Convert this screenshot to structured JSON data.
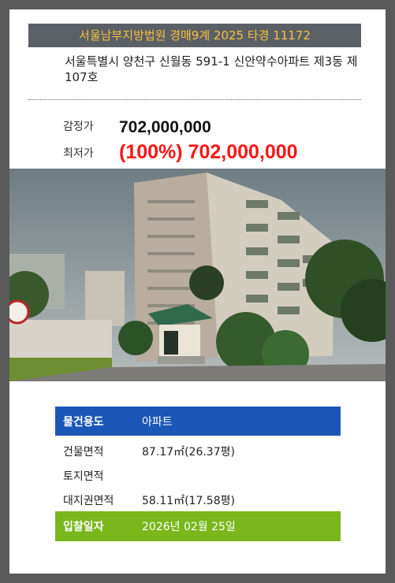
{
  "header": {
    "title": "서울남부지방법원 경매9계 2025 타경 11172"
  },
  "property": {
    "address": "서울특별시 양천구 신월동 591-1 신안약수아파트 제3동 제107호"
  },
  "prices": {
    "appraisal_label": "감정가",
    "appraisal_value": "702,000,000",
    "minimum_label": "최저가",
    "minimum_value": "(100%) 702,000,000"
  },
  "info": {
    "use_label": "물건용도",
    "use_value": "아파트",
    "building_area_label": "건물면적",
    "building_area_value": "87.17㎡(26.37평)",
    "land_area_label": "토지면적",
    "land_area_value": "",
    "land_right_label": "대지권면적",
    "land_right_value": "58.11㎡(17.58평)",
    "bid_date_label": "입찰일자",
    "bid_date_value": "2026년 02월 25일"
  },
  "colors": {
    "header_bg": "#5b5f66",
    "header_text": "#f5c33b",
    "minimum_price": "#ff1414",
    "use_row": "#1c57b8",
    "bid_row": "#79b71c"
  }
}
